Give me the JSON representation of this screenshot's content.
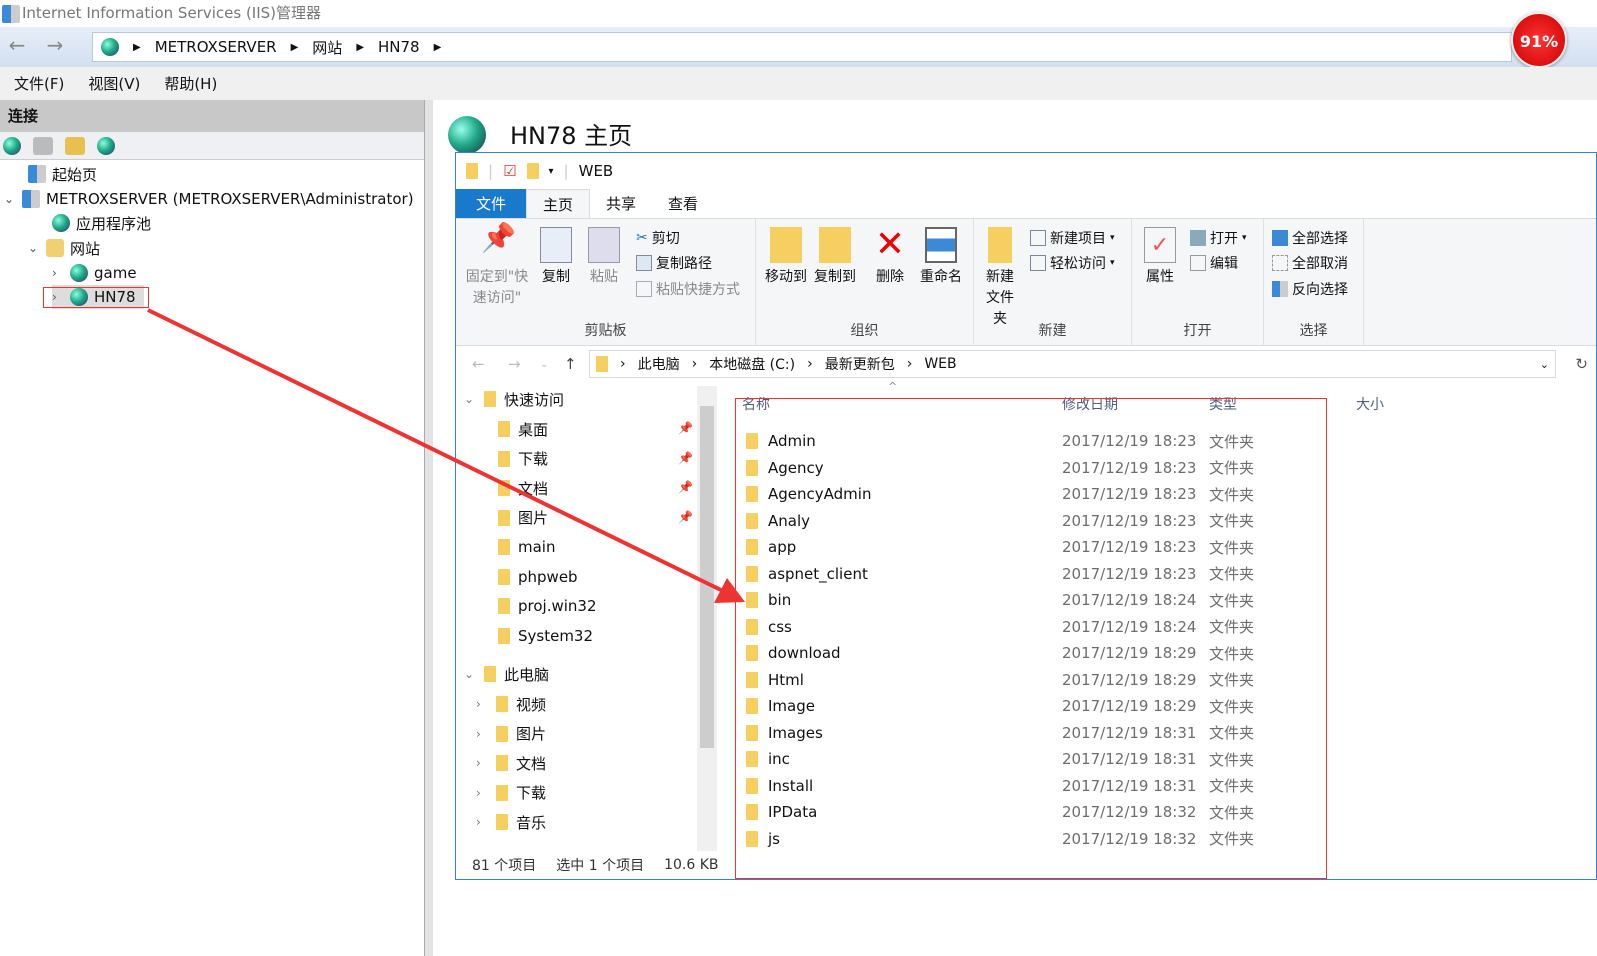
{
  "window": {
    "title": "Internet Information Services (IIS)管理器",
    "progress_badge": "91%"
  },
  "address": {
    "crumbs": [
      "METROXSERVER",
      "网站",
      "HN78"
    ]
  },
  "menu": [
    "文件(F)",
    "视图(V)",
    "帮助(H)"
  ],
  "connections": {
    "header": "连接",
    "tree": [
      "起始页",
      "METROXSERVER (METROXSERVER\\Administrator)",
      "应用程序池",
      "网站",
      "game",
      "HN78"
    ]
  },
  "page": {
    "title": "HN78 主页"
  },
  "explorer": {
    "qat_title": "WEB",
    "tabs": [
      "文件",
      "主页",
      "共享",
      "查看"
    ],
    "ribbon": {
      "clipboard": {
        "label": "剪贴板",
        "pin": "固定到\"快速访问\"",
        "copy": "复制",
        "paste": "粘贴",
        "cut": "剪切",
        "copy_path": "复制路径",
        "paste_shortcut": "粘贴快捷方式"
      },
      "organize": {
        "label": "组织",
        "move_to": "移动到",
        "copy_to": "复制到",
        "delete": "删除",
        "rename": "重命名"
      },
      "new": {
        "label": "新建",
        "new_folder": "新建\n文件夹",
        "new_item": "新建项目",
        "easy_access": "轻松访问"
      },
      "open": {
        "label": "打开",
        "properties": "属性",
        "open": "打开",
        "edit": "编辑"
      },
      "select": {
        "label": "选择",
        "select_all": "全部选择",
        "select_none": "全部取消",
        "invert": "反向选择"
      }
    },
    "path": [
      "此电脑",
      "本地磁盘 (C:)",
      "最新更新包",
      "WEB"
    ],
    "nav": {
      "quick_access": "快速访问",
      "quick_items": [
        "桌面",
        "下载",
        "文档",
        "图片",
        "main",
        "phpweb",
        "proj.win32",
        "System32"
      ],
      "this_pc": "此电脑",
      "pc_items": [
        "视频",
        "图片",
        "文档",
        "下载",
        "音乐"
      ]
    },
    "columns": [
      "名称",
      "修改日期",
      "类型",
      "大小"
    ],
    "files": [
      {
        "name": "Admin",
        "date": "2017/12/19 18:23",
        "type": "文件夹"
      },
      {
        "name": "Agency",
        "date": "2017/12/19 18:23",
        "type": "文件夹"
      },
      {
        "name": "AgencyAdmin",
        "date": "2017/12/19 18:23",
        "type": "文件夹"
      },
      {
        "name": "Analy",
        "date": "2017/12/19 18:23",
        "type": "文件夹"
      },
      {
        "name": "app",
        "date": "2017/12/19 18:23",
        "type": "文件夹"
      },
      {
        "name": "aspnet_client",
        "date": "2017/12/19 18:23",
        "type": "文件夹"
      },
      {
        "name": "bin",
        "date": "2017/12/19 18:24",
        "type": "文件夹"
      },
      {
        "name": "css",
        "date": "2017/12/19 18:24",
        "type": "文件夹"
      },
      {
        "name": "download",
        "date": "2017/12/19 18:29",
        "type": "文件夹"
      },
      {
        "name": "Html",
        "date": "2017/12/19 18:29",
        "type": "文件夹"
      },
      {
        "name": "Image",
        "date": "2017/12/19 18:29",
        "type": "文件夹"
      },
      {
        "name": "Images",
        "date": "2017/12/19 18:31",
        "type": "文件夹"
      },
      {
        "name": "inc",
        "date": "2017/12/19 18:31",
        "type": "文件夹"
      },
      {
        "name": "Install",
        "date": "2017/12/19 18:31",
        "type": "文件夹"
      },
      {
        "name": "IPData",
        "date": "2017/12/19 18:32",
        "type": "文件夹"
      },
      {
        "name": "js",
        "date": "2017/12/19 18:32",
        "type": "文件夹"
      }
    ],
    "status": {
      "count": "81 个项目",
      "selected": "选中 1 个项目",
      "size": "10.6 KB"
    }
  },
  "colors": {
    "accent": "#1979ca",
    "annotation": "#e33333",
    "folder": "#f5cf60"
  }
}
